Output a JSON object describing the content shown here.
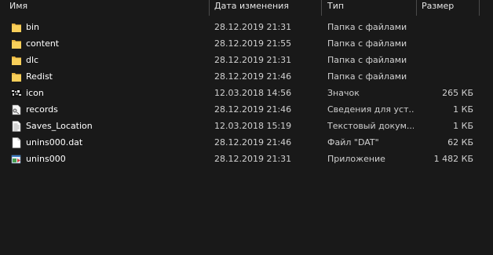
{
  "header": {
    "name": "Имя",
    "date": "Дата изменения",
    "type": "Тип",
    "size": "Размер"
  },
  "files": [
    {
      "name": "bin",
      "date": "28.12.2019 21:31",
      "type": "Папка с файлами",
      "size": "",
      "icon": "folder-icon"
    },
    {
      "name": "content",
      "date": "28.12.2019 21:55",
      "type": "Папка с файлами",
      "size": "",
      "icon": "folder-icon"
    },
    {
      "name": "dlc",
      "date": "28.12.2019 21:31",
      "type": "Папка с файлами",
      "size": "",
      "icon": "folder-icon"
    },
    {
      "name": "Redist",
      "date": "28.12.2019 21:46",
      "type": "Папка с файлами",
      "size": "",
      "icon": "folder-icon"
    },
    {
      "name": "icon",
      "date": "12.03.2018 14:56",
      "type": "Значок",
      "size": "265 КБ",
      "icon": "ico-file-icon"
    },
    {
      "name": "records",
      "date": "28.12.2019 21:46",
      "type": "Сведения для уст...",
      "size": "1 КБ",
      "icon": "setup-info-icon"
    },
    {
      "name": "Saves_Location",
      "date": "12.03.2018 15:19",
      "type": "Текстовый докум...",
      "size": "1 КБ",
      "icon": "text-document-icon"
    },
    {
      "name": "unins000.dat",
      "date": "28.12.2019 21:46",
      "type": "Файл \"DAT\"",
      "size": "62 КБ",
      "icon": "file-icon"
    },
    {
      "name": "unins000",
      "date": "28.12.2019 21:31",
      "type": "Приложение",
      "size": "1 482 КБ",
      "icon": "application-icon"
    }
  ]
}
